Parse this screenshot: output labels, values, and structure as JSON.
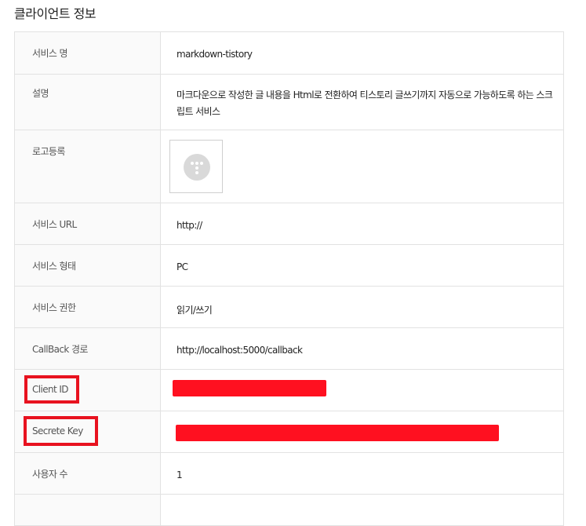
{
  "page": {
    "title": "클라이언트 정보"
  },
  "rows": {
    "service_name": {
      "label": "서비스 명",
      "value": "markdown-tistory"
    },
    "description": {
      "label": "설명",
      "value": "마크다운으로 작성한 글 내용을 Html로 전환하여 티스토리 글쓰기까지 자동으로 가능하도록 하는 스크립트 서비스"
    },
    "logo": {
      "label": "로고등록",
      "icon": "tistory-logo-icon"
    },
    "service_url": {
      "label": "서비스 URL",
      "value": "http://"
    },
    "service_type": {
      "label": "서비스 형태",
      "value": "PC"
    },
    "permission": {
      "label": "서비스 권한",
      "value": "읽기/쓰기"
    },
    "callback": {
      "label": "CallBack 경로",
      "value": "http://localhost:5000/callback"
    },
    "client_id": {
      "label": "Client ID",
      "value_redacted": true
    },
    "secret_key": {
      "label": "Secrete Key",
      "value_redacted": true
    },
    "user_count": {
      "label": "사용자 수",
      "value": "1"
    }
  },
  "colors": {
    "highlight": "#e8121f",
    "redaction": "#ff1020",
    "label_bg": "#fafafa",
    "border": "#e2e2e2"
  }
}
